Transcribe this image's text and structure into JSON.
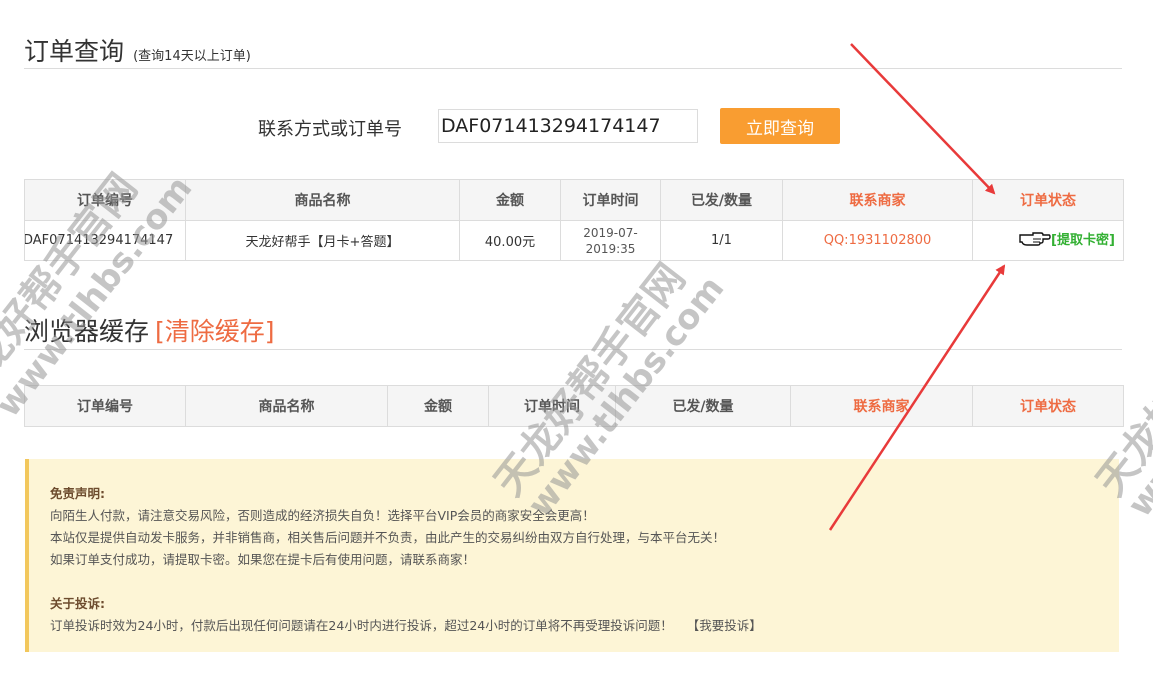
{
  "order_query": {
    "title": "订单查询",
    "subtitle": "(查询14天以上订单)",
    "search_label": "联系方式或订单号",
    "search_value": "DAF071413294174147",
    "search_button": "立即查询",
    "headers": [
      "订单编号",
      "商品名称",
      "金额",
      "订单时间",
      "已发/数量",
      "联系商家",
      "订单状态"
    ],
    "row": {
      "order_id": "DAF071413294174147",
      "product": "天龙好帮手【月卡+答题】",
      "amount": "40.00元",
      "time_line1": "2019-07-",
      "time_line2": "2019:35",
      "quantity": "1/1",
      "contact": "QQ:1931102800",
      "status_icon": "pointing-hand-icon",
      "status_link": "[提取卡密]"
    }
  },
  "browser_cache": {
    "title": "浏览器缓存",
    "clear_link": "[清除缓存]",
    "headers": [
      "订单编号",
      "商品名称",
      "金额",
      "订单时间",
      "已发/数量",
      "联系商家",
      "订单状态"
    ]
  },
  "notice": {
    "disclaimer_title": "免责声明:",
    "disclaimer_lines": [
      "向陌生人付款，请注意交易风险，否则造成的经济损失自负！选择平台VIP会员的商家安全会更高！",
      "本站仅是提供自动发卡服务，并非销售商，相关售后问题并不负责，由此产生的交易纠纷由双方自行处理，与本平台无关！",
      "如果订单支付成功，请提取卡密。如果您在提卡后有使用问题，请联系商家！"
    ],
    "complaint_title": "关于投诉:",
    "complaint_text": "订单投诉时效为24小时，付款后出现任何问题请在24小时内进行投诉，超过24小时的订单将不再受理投诉问题！",
    "complaint_link": "【我要投诉】"
  },
  "watermark": {
    "line1": "天龙好帮手官网",
    "line2": "www.tlhbs.com"
  },
  "colors": {
    "accent": "#f99d31",
    "link_orange": "#ee6b42",
    "status_green": "#33b033",
    "arrow_red": "#e83a3a",
    "notice_bg": "#fdf5d6"
  }
}
